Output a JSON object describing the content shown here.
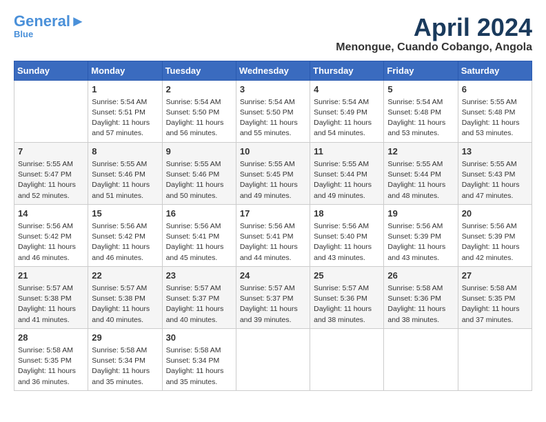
{
  "header": {
    "logo_line1": "General",
    "logo_line2": "Blue",
    "title": "April 2024",
    "subtitle": "Menongue, Cuando Cobango, Angola"
  },
  "weekdays": [
    "Sunday",
    "Monday",
    "Tuesday",
    "Wednesday",
    "Thursday",
    "Friday",
    "Saturday"
  ],
  "weeks": [
    [
      {
        "day": "",
        "info": ""
      },
      {
        "day": "1",
        "info": "Sunrise: 5:54 AM\nSunset: 5:51 PM\nDaylight: 11 hours\nand 57 minutes."
      },
      {
        "day": "2",
        "info": "Sunrise: 5:54 AM\nSunset: 5:50 PM\nDaylight: 11 hours\nand 56 minutes."
      },
      {
        "day": "3",
        "info": "Sunrise: 5:54 AM\nSunset: 5:50 PM\nDaylight: 11 hours\nand 55 minutes."
      },
      {
        "day": "4",
        "info": "Sunrise: 5:54 AM\nSunset: 5:49 PM\nDaylight: 11 hours\nand 54 minutes."
      },
      {
        "day": "5",
        "info": "Sunrise: 5:54 AM\nSunset: 5:48 PM\nDaylight: 11 hours\nand 53 minutes."
      },
      {
        "day": "6",
        "info": "Sunrise: 5:55 AM\nSunset: 5:48 PM\nDaylight: 11 hours\nand 53 minutes."
      }
    ],
    [
      {
        "day": "7",
        "info": "Sunrise: 5:55 AM\nSunset: 5:47 PM\nDaylight: 11 hours\nand 52 minutes."
      },
      {
        "day": "8",
        "info": "Sunrise: 5:55 AM\nSunset: 5:46 PM\nDaylight: 11 hours\nand 51 minutes."
      },
      {
        "day": "9",
        "info": "Sunrise: 5:55 AM\nSunset: 5:46 PM\nDaylight: 11 hours\nand 50 minutes."
      },
      {
        "day": "10",
        "info": "Sunrise: 5:55 AM\nSunset: 5:45 PM\nDaylight: 11 hours\nand 49 minutes."
      },
      {
        "day": "11",
        "info": "Sunrise: 5:55 AM\nSunset: 5:44 PM\nDaylight: 11 hours\nand 49 minutes."
      },
      {
        "day": "12",
        "info": "Sunrise: 5:55 AM\nSunset: 5:44 PM\nDaylight: 11 hours\nand 48 minutes."
      },
      {
        "day": "13",
        "info": "Sunrise: 5:55 AM\nSunset: 5:43 PM\nDaylight: 11 hours\nand 47 minutes."
      }
    ],
    [
      {
        "day": "14",
        "info": "Sunrise: 5:56 AM\nSunset: 5:42 PM\nDaylight: 11 hours\nand 46 minutes."
      },
      {
        "day": "15",
        "info": "Sunrise: 5:56 AM\nSunset: 5:42 PM\nDaylight: 11 hours\nand 46 minutes."
      },
      {
        "day": "16",
        "info": "Sunrise: 5:56 AM\nSunset: 5:41 PM\nDaylight: 11 hours\nand 45 minutes."
      },
      {
        "day": "17",
        "info": "Sunrise: 5:56 AM\nSunset: 5:41 PM\nDaylight: 11 hours\nand 44 minutes."
      },
      {
        "day": "18",
        "info": "Sunrise: 5:56 AM\nSunset: 5:40 PM\nDaylight: 11 hours\nand 43 minutes."
      },
      {
        "day": "19",
        "info": "Sunrise: 5:56 AM\nSunset: 5:39 PM\nDaylight: 11 hours\nand 43 minutes."
      },
      {
        "day": "20",
        "info": "Sunrise: 5:56 AM\nSunset: 5:39 PM\nDaylight: 11 hours\nand 42 minutes."
      }
    ],
    [
      {
        "day": "21",
        "info": "Sunrise: 5:57 AM\nSunset: 5:38 PM\nDaylight: 11 hours\nand 41 minutes."
      },
      {
        "day": "22",
        "info": "Sunrise: 5:57 AM\nSunset: 5:38 PM\nDaylight: 11 hours\nand 40 minutes."
      },
      {
        "day": "23",
        "info": "Sunrise: 5:57 AM\nSunset: 5:37 PM\nDaylight: 11 hours\nand 40 minutes."
      },
      {
        "day": "24",
        "info": "Sunrise: 5:57 AM\nSunset: 5:37 PM\nDaylight: 11 hours\nand 39 minutes."
      },
      {
        "day": "25",
        "info": "Sunrise: 5:57 AM\nSunset: 5:36 PM\nDaylight: 11 hours\nand 38 minutes."
      },
      {
        "day": "26",
        "info": "Sunrise: 5:58 AM\nSunset: 5:36 PM\nDaylight: 11 hours\nand 38 minutes."
      },
      {
        "day": "27",
        "info": "Sunrise: 5:58 AM\nSunset: 5:35 PM\nDaylight: 11 hours\nand 37 minutes."
      }
    ],
    [
      {
        "day": "28",
        "info": "Sunrise: 5:58 AM\nSunset: 5:35 PM\nDaylight: 11 hours\nand 36 minutes."
      },
      {
        "day": "29",
        "info": "Sunrise: 5:58 AM\nSunset: 5:34 PM\nDaylight: 11 hours\nand 35 minutes."
      },
      {
        "day": "30",
        "info": "Sunrise: 5:58 AM\nSunset: 5:34 PM\nDaylight: 11 hours\nand 35 minutes."
      },
      {
        "day": "",
        "info": ""
      },
      {
        "day": "",
        "info": ""
      },
      {
        "day": "",
        "info": ""
      },
      {
        "day": "",
        "info": ""
      }
    ]
  ]
}
